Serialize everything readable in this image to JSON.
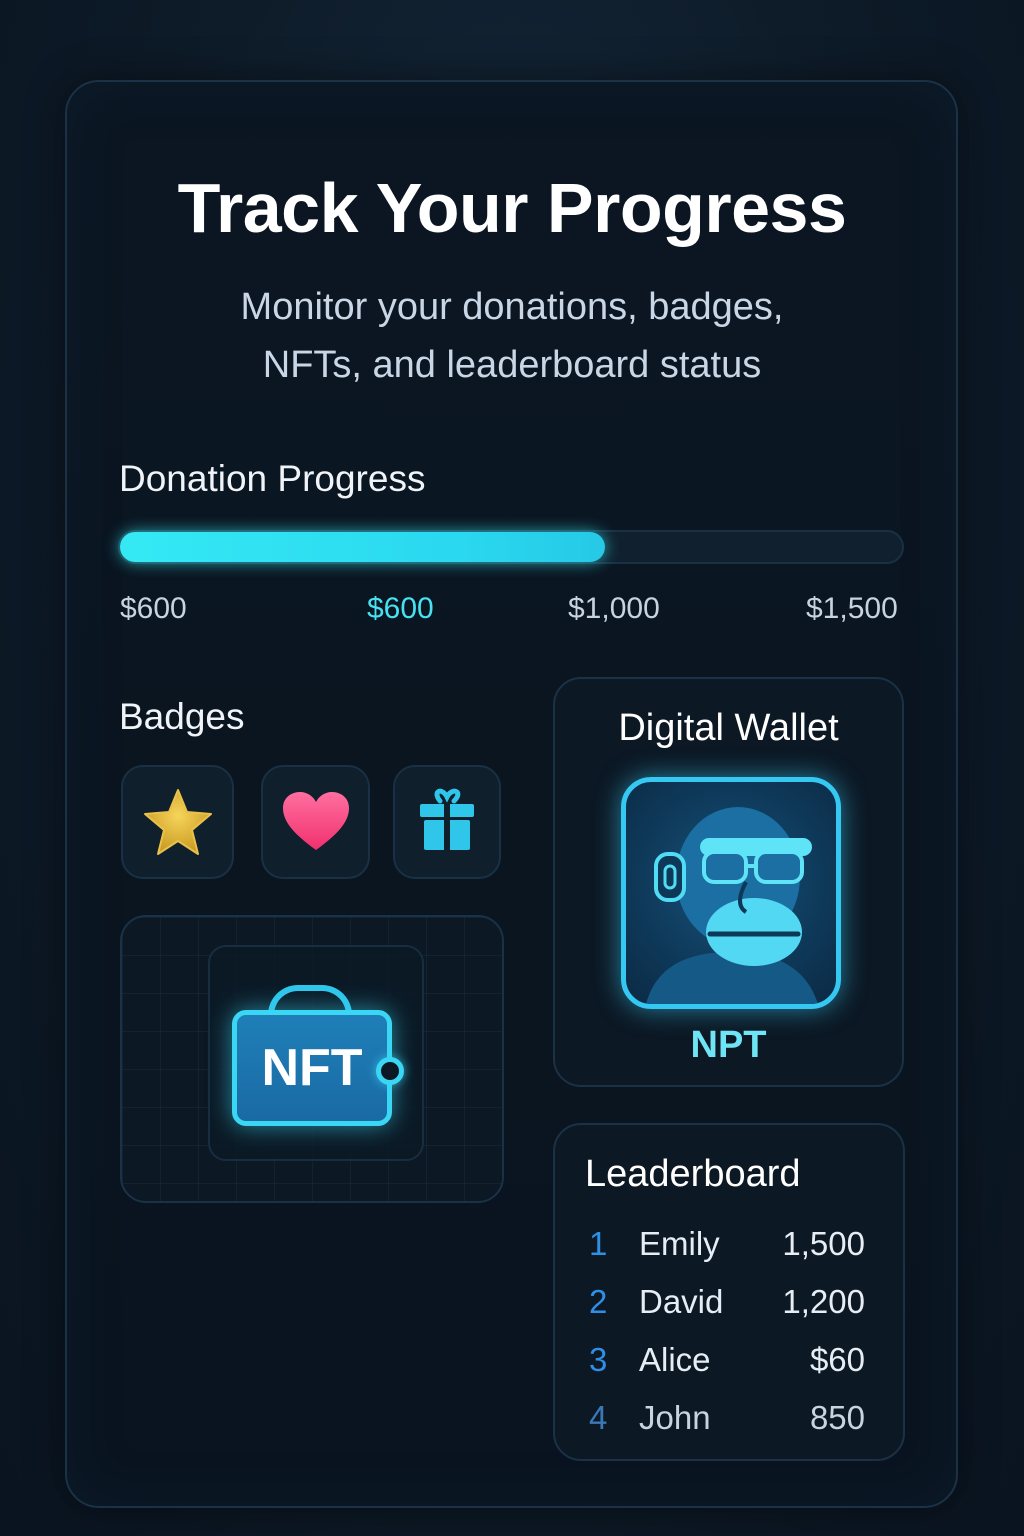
{
  "header": {
    "title": "Track Your Progress",
    "subtitle_line1": "Monitor your donations, badges,",
    "subtitle_line2": "NFTs, and leaderboard status"
  },
  "donation": {
    "heading": "Donation Progress",
    "progress_fraction": 0.62,
    "ticks": [
      "$600",
      "$600",
      "$1,000",
      "$1,500"
    ],
    "active_tick_index": 1,
    "accent_color": "#35e9f4"
  },
  "badges": {
    "heading": "Badges",
    "items": [
      {
        "icon": "star-icon",
        "color": "#e6b93a"
      },
      {
        "icon": "heart-icon",
        "color": "#ff4f8f"
      },
      {
        "icon": "gift-icon",
        "color": "#2fc6ea"
      }
    ]
  },
  "nft": {
    "label": "NFT"
  },
  "wallet": {
    "title": "Digital Wallet",
    "nft_label": "NPT"
  },
  "leaderboard": {
    "title": "Leaderboard",
    "rows": [
      {
        "rank": "1",
        "name": "Emily",
        "score": "1,500"
      },
      {
        "rank": "2",
        "name": "David",
        "score": "1,200"
      },
      {
        "rank": "3",
        "name": "Alice",
        "score": "$60"
      },
      {
        "rank": "4",
        "name": "John",
        "score": "850"
      }
    ]
  }
}
